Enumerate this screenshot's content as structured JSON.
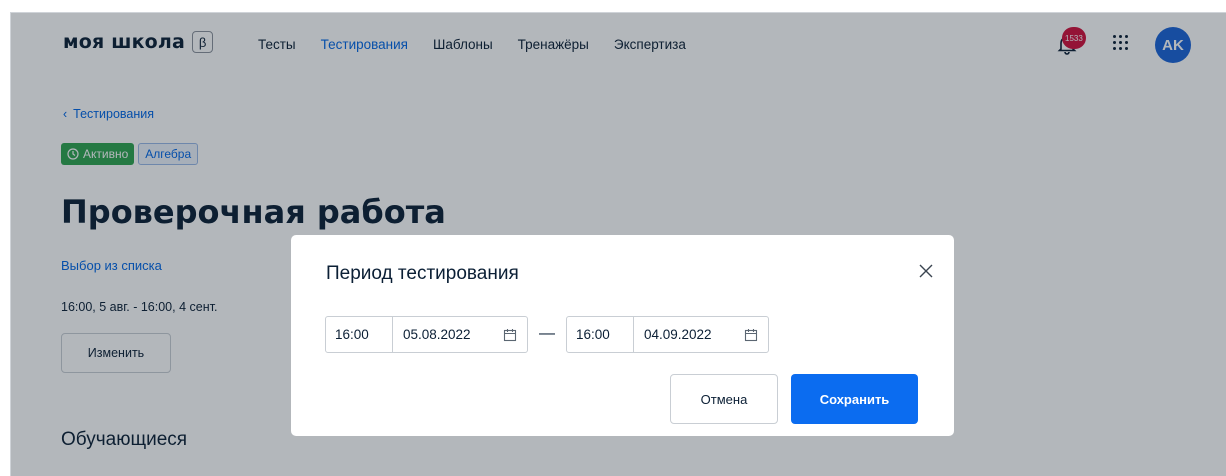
{
  "header": {
    "logo": "моя школа",
    "beta": "β",
    "nav": [
      {
        "label": "Тесты",
        "active": false
      },
      {
        "label": "Тестирования",
        "active": true
      },
      {
        "label": "Шаблоны",
        "active": false
      },
      {
        "label": "Тренажёры",
        "active": false
      },
      {
        "label": "Экспертиза",
        "active": false
      }
    ],
    "notifications_count": "1533",
    "avatar_initials": "AK"
  },
  "page": {
    "back_link": "Тестирования",
    "status_tag": "Активно",
    "subject_tag": "Алгебра",
    "title": "Проверочная работа",
    "choice_link": "Выбор из списка",
    "period_text": "16:00, 5 авг. - 16:00, 4 сент.",
    "change_button": "Изменить",
    "students_heading": "Обучающиеся"
  },
  "modal": {
    "title": "Период тестирования",
    "start_time": "16:00",
    "start_date": "05.08.2022",
    "separator": "—",
    "end_time": "16:00",
    "end_date": "04.09.2022",
    "cancel_label": "Отмена",
    "save_label": "Сохранить"
  },
  "colors": {
    "accent": "#0066e6",
    "primary_button": "#0b6cf0",
    "active_tag": "#2ea44f",
    "badge": "#d2103c",
    "avatar": "#1a63d8"
  }
}
